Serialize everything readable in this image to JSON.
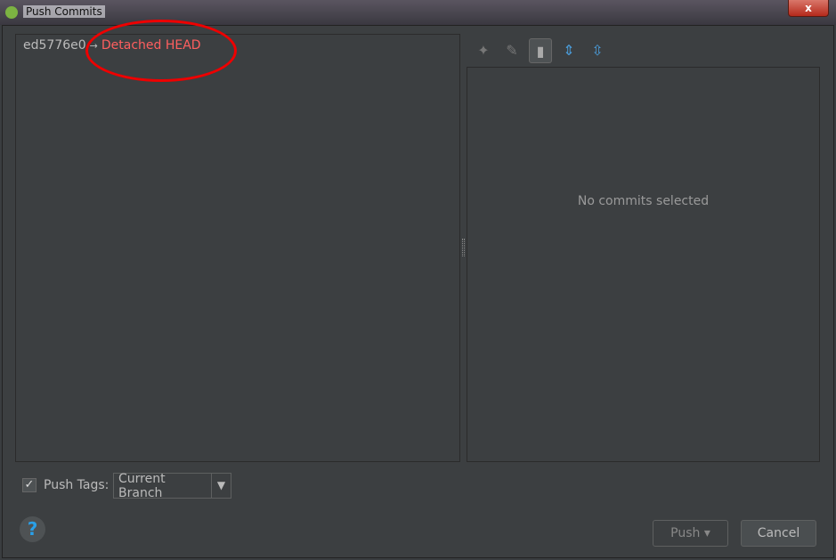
{
  "window": {
    "title": "Push Commits",
    "close_label": "x"
  },
  "commits": {
    "hash": "ed5776e0",
    "arrow": "→",
    "target": "Detached HEAD"
  },
  "toolbar": {
    "icons": [
      "cherry-pick-icon",
      "edit-source-icon",
      "show-details-icon",
      "expand-all-icon",
      "collapse-all-icon"
    ],
    "glyphs": [
      "✦",
      "✎",
      "▮",
      "⇕",
      "⇳"
    ]
  },
  "details": {
    "empty_text": "No commits selected"
  },
  "push_tags": {
    "checked": true,
    "check_glyph": "✓",
    "label": "Push Tags:",
    "selected": "Current Branch",
    "dropdown_glyph": "▼"
  },
  "buttons": {
    "help": "?",
    "push": "Push ▾",
    "cancel": "Cancel"
  },
  "colors": {
    "detached_head": "#ff5f5f",
    "annotation": "#ee0000",
    "help_icon": "#2aa0e8"
  }
}
